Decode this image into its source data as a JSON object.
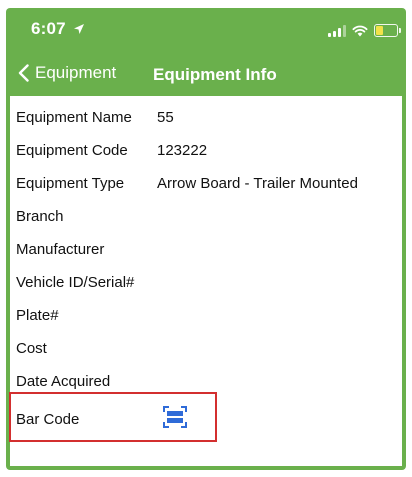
{
  "status_bar": {
    "time": "6:07"
  },
  "nav": {
    "back_label": "Equipment",
    "title": "Equipment Info"
  },
  "fields": [
    {
      "label": "Equipment Name",
      "value": "55"
    },
    {
      "label": "Equipment Code",
      "value": "123222"
    },
    {
      "label": "Equipment Type",
      "value": "Arrow Board - Trailer Mounted"
    },
    {
      "label": "Branch",
      "value": ""
    },
    {
      "label": "Manufacturer",
      "value": ""
    },
    {
      "label": "Vehicle ID/Serial#",
      "value": ""
    },
    {
      "label": "Plate#",
      "value": ""
    },
    {
      "label": "Cost",
      "value": ""
    },
    {
      "label": "Date Acquired",
      "value": ""
    }
  ],
  "barcode": {
    "label": "Bar Code",
    "icon": "barcode-scan-icon"
  },
  "colors": {
    "header": "#6ab04c",
    "scan_icon": "#2f6bd8",
    "highlight": "#d32f2f"
  }
}
